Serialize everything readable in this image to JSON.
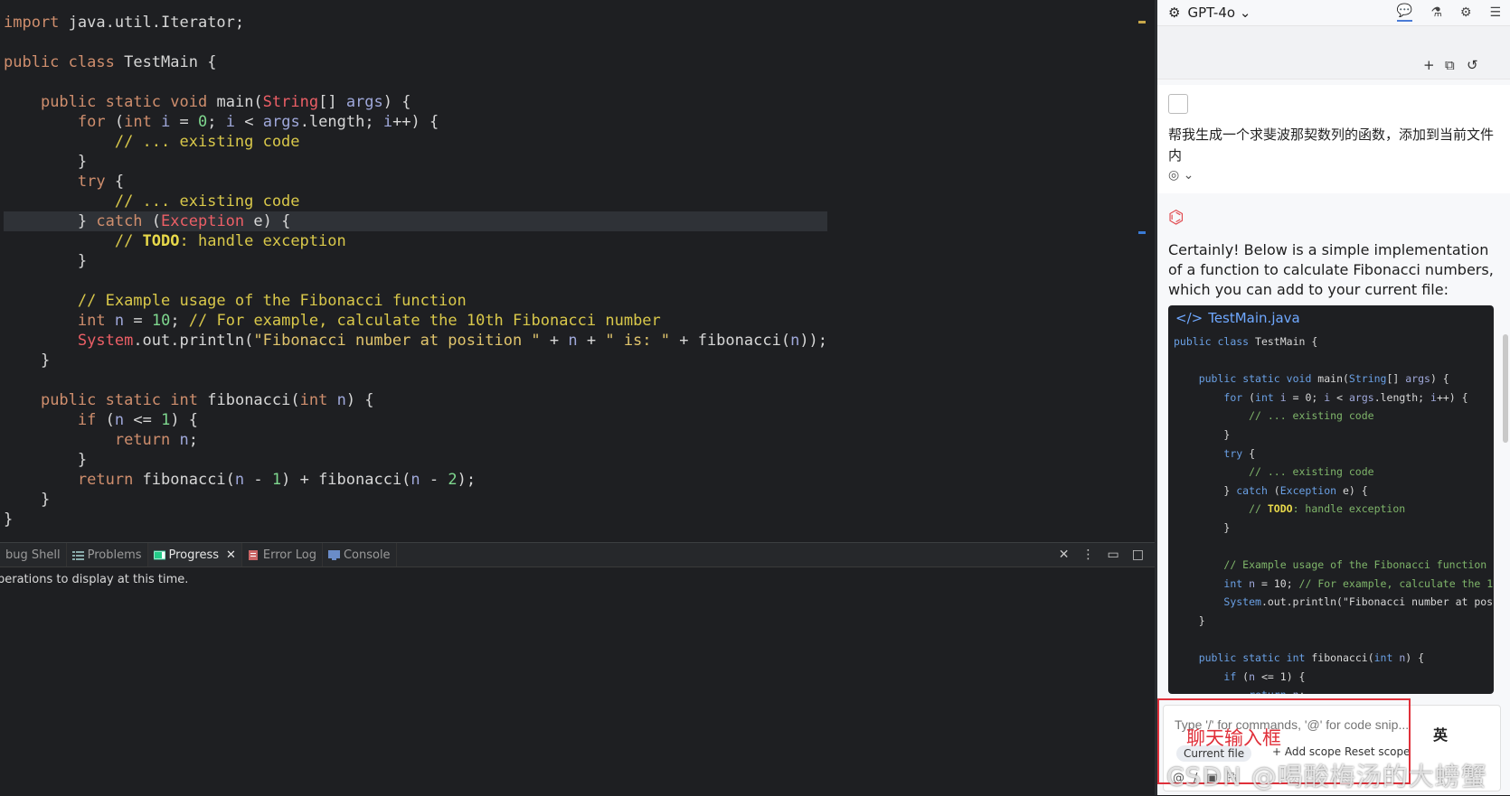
{
  "editor": {
    "lines": [
      "import java.util.Iterator;",
      "",
      "public class TestMain {",
      "",
      "    public static void main(String[] args) {",
      "        for (int i = 0; i < args.length; i++) {",
      "            // ... existing code",
      "        }",
      "        try {",
      "            // ... existing code",
      "        } catch (Exception e) {",
      "            // TODO: handle exception",
      "        }",
      "",
      "        // Example usage of the Fibonacci function",
      "        int n = 10; // For example, calculate the 10th Fibonacci number",
      "        System.out.println(\"Fibonacci number at position \" + n + \" is: \" + fibonacci(n));",
      "    }",
      "",
      "    public static int fibonacci(int n) {",
      "        if (n <= 1) {",
      "            return n;",
      "        }",
      "        return fibonacci(n - 1) + fibonacci(n - 2);",
      "    }",
      "}"
    ]
  },
  "bottom_panel": {
    "tabs": [
      {
        "label": "bug Shell",
        "icon": "debug-shell-icon",
        "active": false
      },
      {
        "label": "Problems",
        "icon": "problems-icon",
        "active": false
      },
      {
        "label": "Progress",
        "icon": "progress-icon",
        "active": true
      },
      {
        "label": "Error Log",
        "icon": "error-log-icon",
        "active": false
      },
      {
        "label": "Console",
        "icon": "console-icon",
        "active": false
      }
    ],
    "message": "perations to display at this time."
  },
  "chat": {
    "model": "GPT-4o",
    "user_message": "帮我生成一个求斐波那契数列的函数，添加到当前文件内",
    "assistant_intro": "Certainly! Below is a simple implementation of a function to calculate Fibonacci numbers, which you can add to your current file:",
    "code_file": "TestMain.java",
    "code_lines": [
      "public class TestMain {",
      "",
      "    public static void main(String[] args) {",
      "        for (int i = 0; i < args.length; i++) {",
      "            // ... existing code",
      "        }",
      "        try {",
      "            // ... existing code",
      "        } catch (Exception e) {",
      "            // TODO: handle exception",
      "        }",
      "",
      "        // Example usage of the Fibonacci function",
      "        int n = 10; // For example, calculate the 1",
      "        System.out.println(\"Fibonacci number at pos",
      "    }",
      "",
      "    public static int fibonacci(int n) {",
      "        if (n <= 1) {",
      "            return n;"
    ],
    "input_placeholder": "Type '/' for commands, '@' for code snip...",
    "pill_current_file": "Current file",
    "pill_add_scope": "+ Add scope",
    "pill_reset_scope": "Reset scope",
    "annotation": "聊天输入框",
    "ime_indicator": "英",
    "watermark": "CSDN @喝酸梅汤的大螃蟹"
  }
}
